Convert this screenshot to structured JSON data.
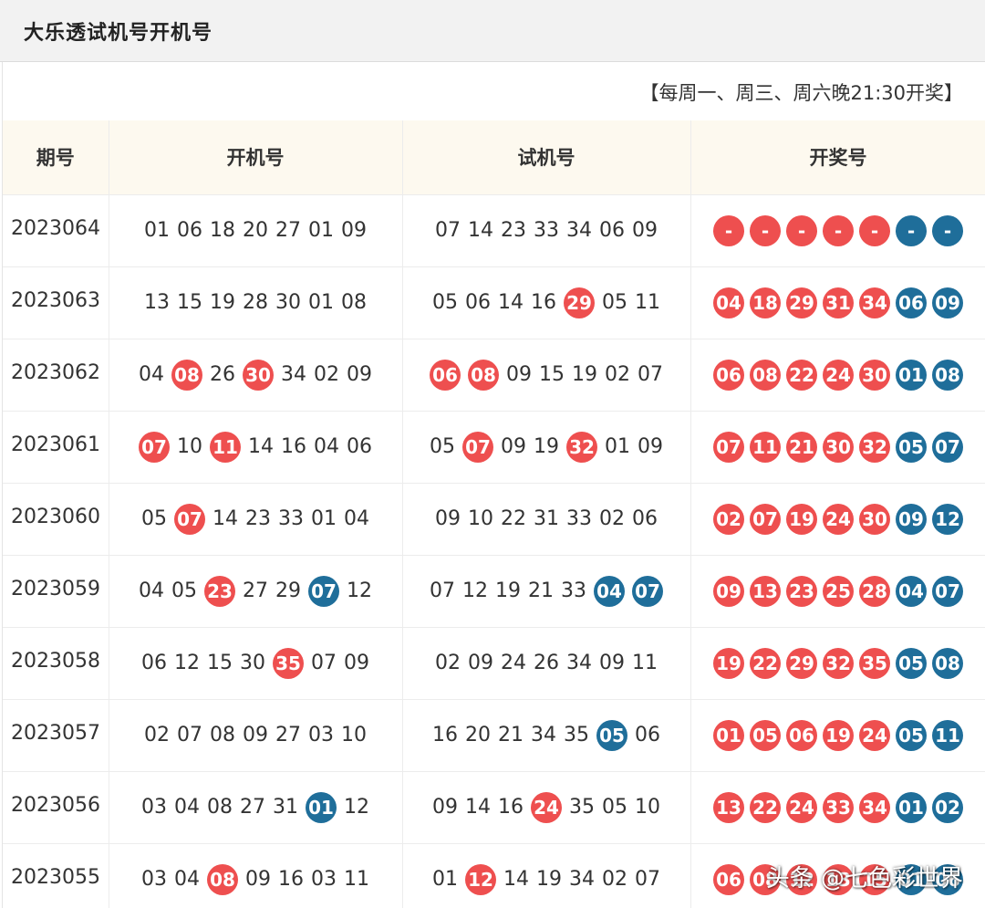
{
  "header": {
    "title": "大乐透试机号开机号"
  },
  "schedule": "【每周一、周三、周六晚21:30开奖】",
  "columns": [
    "期号",
    "开机号",
    "试机号",
    "开奖号"
  ],
  "rows": [
    {
      "period": "2023064",
      "open": [
        {
          "v": "01",
          "c": ""
        },
        {
          "v": "06",
          "c": ""
        },
        {
          "v": "18",
          "c": ""
        },
        {
          "v": "20",
          "c": ""
        },
        {
          "v": "27",
          "c": ""
        },
        {
          "v": "01",
          "c": ""
        },
        {
          "v": "09",
          "c": ""
        }
      ],
      "test": [
        {
          "v": "07",
          "c": ""
        },
        {
          "v": "14",
          "c": ""
        },
        {
          "v": "23",
          "c": ""
        },
        {
          "v": "33",
          "c": ""
        },
        {
          "v": "34",
          "c": ""
        },
        {
          "v": "06",
          "c": ""
        },
        {
          "v": "09",
          "c": ""
        }
      ],
      "result": [
        {
          "v": "-",
          "c": "red"
        },
        {
          "v": "-",
          "c": "red"
        },
        {
          "v": "-",
          "c": "red"
        },
        {
          "v": "-",
          "c": "red"
        },
        {
          "v": "-",
          "c": "red"
        },
        {
          "v": "-",
          "c": "blue"
        },
        {
          "v": "-",
          "c": "blue"
        }
      ]
    },
    {
      "period": "2023063",
      "open": [
        {
          "v": "13",
          "c": ""
        },
        {
          "v": "15",
          "c": ""
        },
        {
          "v": "19",
          "c": ""
        },
        {
          "v": "28",
          "c": ""
        },
        {
          "v": "30",
          "c": ""
        },
        {
          "v": "01",
          "c": ""
        },
        {
          "v": "08",
          "c": ""
        }
      ],
      "test": [
        {
          "v": "05",
          "c": ""
        },
        {
          "v": "06",
          "c": ""
        },
        {
          "v": "14",
          "c": ""
        },
        {
          "v": "16",
          "c": ""
        },
        {
          "v": "29",
          "c": "red"
        },
        {
          "v": "05",
          "c": ""
        },
        {
          "v": "11",
          "c": ""
        }
      ],
      "result": [
        {
          "v": "04",
          "c": "red"
        },
        {
          "v": "18",
          "c": "red"
        },
        {
          "v": "29",
          "c": "red"
        },
        {
          "v": "31",
          "c": "red"
        },
        {
          "v": "34",
          "c": "red"
        },
        {
          "v": "06",
          "c": "blue"
        },
        {
          "v": "09",
          "c": "blue"
        }
      ]
    },
    {
      "period": "2023062",
      "open": [
        {
          "v": "04",
          "c": ""
        },
        {
          "v": "08",
          "c": "red"
        },
        {
          "v": "26",
          "c": ""
        },
        {
          "v": "30",
          "c": "red"
        },
        {
          "v": "34",
          "c": ""
        },
        {
          "v": "02",
          "c": ""
        },
        {
          "v": "09",
          "c": ""
        }
      ],
      "test": [
        {
          "v": "06",
          "c": "red"
        },
        {
          "v": "08",
          "c": "red"
        },
        {
          "v": "09",
          "c": ""
        },
        {
          "v": "15",
          "c": ""
        },
        {
          "v": "19",
          "c": ""
        },
        {
          "v": "02",
          "c": ""
        },
        {
          "v": "07",
          "c": ""
        }
      ],
      "result": [
        {
          "v": "06",
          "c": "red"
        },
        {
          "v": "08",
          "c": "red"
        },
        {
          "v": "22",
          "c": "red"
        },
        {
          "v": "24",
          "c": "red"
        },
        {
          "v": "30",
          "c": "red"
        },
        {
          "v": "01",
          "c": "blue"
        },
        {
          "v": "08",
          "c": "blue"
        }
      ]
    },
    {
      "period": "2023061",
      "open": [
        {
          "v": "07",
          "c": "red"
        },
        {
          "v": "10",
          "c": ""
        },
        {
          "v": "11",
          "c": "red"
        },
        {
          "v": "14",
          "c": ""
        },
        {
          "v": "16",
          "c": ""
        },
        {
          "v": "04",
          "c": ""
        },
        {
          "v": "06",
          "c": ""
        }
      ],
      "test": [
        {
          "v": "05",
          "c": ""
        },
        {
          "v": "07",
          "c": "red"
        },
        {
          "v": "09",
          "c": ""
        },
        {
          "v": "19",
          "c": ""
        },
        {
          "v": "32",
          "c": "red"
        },
        {
          "v": "01",
          "c": ""
        },
        {
          "v": "09",
          "c": ""
        }
      ],
      "result": [
        {
          "v": "07",
          "c": "red"
        },
        {
          "v": "11",
          "c": "red"
        },
        {
          "v": "21",
          "c": "red"
        },
        {
          "v": "30",
          "c": "red"
        },
        {
          "v": "32",
          "c": "red"
        },
        {
          "v": "05",
          "c": "blue"
        },
        {
          "v": "07",
          "c": "blue"
        }
      ]
    },
    {
      "period": "2023060",
      "open": [
        {
          "v": "05",
          "c": ""
        },
        {
          "v": "07",
          "c": "red"
        },
        {
          "v": "14",
          "c": ""
        },
        {
          "v": "23",
          "c": ""
        },
        {
          "v": "33",
          "c": ""
        },
        {
          "v": "01",
          "c": ""
        },
        {
          "v": "04",
          "c": ""
        }
      ],
      "test": [
        {
          "v": "09",
          "c": ""
        },
        {
          "v": "10",
          "c": ""
        },
        {
          "v": "22",
          "c": ""
        },
        {
          "v": "31",
          "c": ""
        },
        {
          "v": "33",
          "c": ""
        },
        {
          "v": "02",
          "c": ""
        },
        {
          "v": "06",
          "c": ""
        }
      ],
      "result": [
        {
          "v": "02",
          "c": "red"
        },
        {
          "v": "07",
          "c": "red"
        },
        {
          "v": "19",
          "c": "red"
        },
        {
          "v": "24",
          "c": "red"
        },
        {
          "v": "30",
          "c": "red"
        },
        {
          "v": "09",
          "c": "blue"
        },
        {
          "v": "12",
          "c": "blue"
        }
      ]
    },
    {
      "period": "2023059",
      "open": [
        {
          "v": "04",
          "c": ""
        },
        {
          "v": "05",
          "c": ""
        },
        {
          "v": "23",
          "c": "red"
        },
        {
          "v": "27",
          "c": ""
        },
        {
          "v": "29",
          "c": ""
        },
        {
          "v": "07",
          "c": "blue"
        },
        {
          "v": "12",
          "c": ""
        }
      ],
      "test": [
        {
          "v": "07",
          "c": ""
        },
        {
          "v": "12",
          "c": ""
        },
        {
          "v": "19",
          "c": ""
        },
        {
          "v": "21",
          "c": ""
        },
        {
          "v": "33",
          "c": ""
        },
        {
          "v": "04",
          "c": "blue"
        },
        {
          "v": "07",
          "c": "blue"
        }
      ],
      "result": [
        {
          "v": "09",
          "c": "red"
        },
        {
          "v": "13",
          "c": "red"
        },
        {
          "v": "23",
          "c": "red"
        },
        {
          "v": "25",
          "c": "red"
        },
        {
          "v": "28",
          "c": "red"
        },
        {
          "v": "04",
          "c": "blue"
        },
        {
          "v": "07",
          "c": "blue"
        }
      ]
    },
    {
      "period": "2023058",
      "open": [
        {
          "v": "06",
          "c": ""
        },
        {
          "v": "12",
          "c": ""
        },
        {
          "v": "15",
          "c": ""
        },
        {
          "v": "30",
          "c": ""
        },
        {
          "v": "35",
          "c": "red"
        },
        {
          "v": "07",
          "c": ""
        },
        {
          "v": "09",
          "c": ""
        }
      ],
      "test": [
        {
          "v": "02",
          "c": ""
        },
        {
          "v": "09",
          "c": ""
        },
        {
          "v": "24",
          "c": ""
        },
        {
          "v": "26",
          "c": ""
        },
        {
          "v": "34",
          "c": ""
        },
        {
          "v": "09",
          "c": ""
        },
        {
          "v": "11",
          "c": ""
        }
      ],
      "result": [
        {
          "v": "19",
          "c": "red"
        },
        {
          "v": "22",
          "c": "red"
        },
        {
          "v": "29",
          "c": "red"
        },
        {
          "v": "32",
          "c": "red"
        },
        {
          "v": "35",
          "c": "red"
        },
        {
          "v": "05",
          "c": "blue"
        },
        {
          "v": "08",
          "c": "blue"
        }
      ]
    },
    {
      "period": "2023057",
      "open": [
        {
          "v": "02",
          "c": ""
        },
        {
          "v": "07",
          "c": ""
        },
        {
          "v": "08",
          "c": ""
        },
        {
          "v": "09",
          "c": ""
        },
        {
          "v": "27",
          "c": ""
        },
        {
          "v": "03",
          "c": ""
        },
        {
          "v": "10",
          "c": ""
        }
      ],
      "test": [
        {
          "v": "16",
          "c": ""
        },
        {
          "v": "20",
          "c": ""
        },
        {
          "v": "21",
          "c": ""
        },
        {
          "v": "34",
          "c": ""
        },
        {
          "v": "35",
          "c": ""
        },
        {
          "v": "05",
          "c": "blue"
        },
        {
          "v": "06",
          "c": ""
        }
      ],
      "result": [
        {
          "v": "01",
          "c": "red"
        },
        {
          "v": "05",
          "c": "red"
        },
        {
          "v": "06",
          "c": "red"
        },
        {
          "v": "19",
          "c": "red"
        },
        {
          "v": "24",
          "c": "red"
        },
        {
          "v": "05",
          "c": "blue"
        },
        {
          "v": "11",
          "c": "blue"
        }
      ]
    },
    {
      "period": "2023056",
      "open": [
        {
          "v": "03",
          "c": ""
        },
        {
          "v": "04",
          "c": ""
        },
        {
          "v": "08",
          "c": ""
        },
        {
          "v": "27",
          "c": ""
        },
        {
          "v": "31",
          "c": ""
        },
        {
          "v": "01",
          "c": "blue"
        },
        {
          "v": "12",
          "c": ""
        }
      ],
      "test": [
        {
          "v": "09",
          "c": ""
        },
        {
          "v": "14",
          "c": ""
        },
        {
          "v": "16",
          "c": ""
        },
        {
          "v": "24",
          "c": "red"
        },
        {
          "v": "35",
          "c": ""
        },
        {
          "v": "05",
          "c": ""
        },
        {
          "v": "10",
          "c": ""
        }
      ],
      "result": [
        {
          "v": "13",
          "c": "red"
        },
        {
          "v": "22",
          "c": "red"
        },
        {
          "v": "24",
          "c": "red"
        },
        {
          "v": "33",
          "c": "red"
        },
        {
          "v": "34",
          "c": "red"
        },
        {
          "v": "01",
          "c": "blue"
        },
        {
          "v": "02",
          "c": "blue"
        }
      ]
    },
    {
      "period": "2023055",
      "open": [
        {
          "v": "03",
          "c": ""
        },
        {
          "v": "04",
          "c": ""
        },
        {
          "v": "08",
          "c": "red"
        },
        {
          "v": "09",
          "c": ""
        },
        {
          "v": "16",
          "c": ""
        },
        {
          "v": "03",
          "c": ""
        },
        {
          "v": "11",
          "c": ""
        }
      ],
      "test": [
        {
          "v": "01",
          "c": ""
        },
        {
          "v": "12",
          "c": "red"
        },
        {
          "v": "14",
          "c": ""
        },
        {
          "v": "19",
          "c": ""
        },
        {
          "v": "34",
          "c": ""
        },
        {
          "v": "02",
          "c": ""
        },
        {
          "v": "07",
          "c": ""
        }
      ],
      "result": [
        {
          "v": "06",
          "c": "red"
        },
        {
          "v": "08",
          "c": "red"
        },
        {
          "v": "12",
          "c": "red"
        },
        {
          "v": "13",
          "c": "red"
        },
        {
          "v": "15",
          "c": "red"
        },
        {
          "v": "01",
          "c": "blue"
        },
        {
          "v": "06",
          "c": "blue"
        }
      ]
    }
  ],
  "watermark": "头条 @七色彩世界",
  "colors": {
    "red_ball": "#ee4f4f",
    "blue_ball": "#1f6e9a",
    "header_bg": "#fdf9ef"
  }
}
